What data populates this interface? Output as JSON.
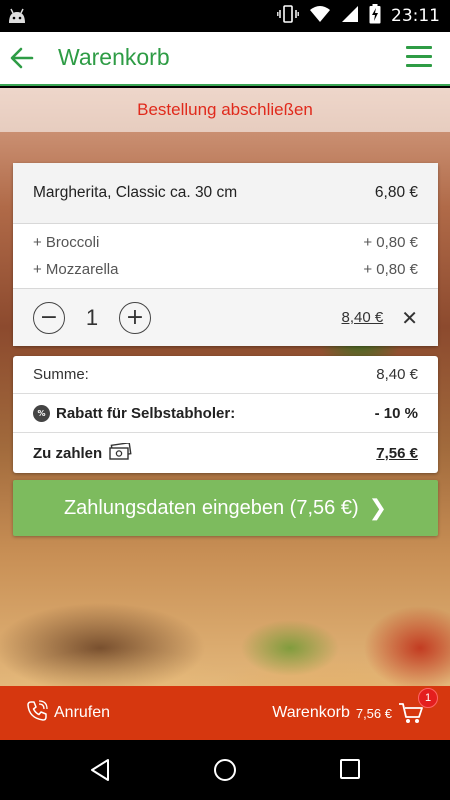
{
  "status_bar": {
    "time": "23:11"
  },
  "app_bar": {
    "title": "Warenkorb"
  },
  "banner": {
    "text": "Bestellung abschließen"
  },
  "item": {
    "name": "Margherita, Classic ca. 30 cm",
    "price": "6,80 €",
    "extras": [
      {
        "label": "+ Broccoli",
        "price": "+ 0,80 €"
      },
      {
        "label": "+ Mozzarella",
        "price": "+ 0,80 €"
      }
    ],
    "quantity": "1",
    "line_total": "8,40 €",
    "minus": "−",
    "plus": "+",
    "remove": "✕"
  },
  "summary": {
    "subtotal_label": "Summe:",
    "subtotal_value": "8,40 €",
    "discount_badge": "%",
    "discount_label": "Rabatt für Selbstabholer:",
    "discount_value": "- 10 %",
    "total_label": "Zu zahlen",
    "total_value": "7,56 €"
  },
  "pay_button": {
    "label": "Zahlungsdaten eingeben (7,56 €)",
    "chevron": "❯"
  },
  "action_bar": {
    "call_label": "Anrufen",
    "cart_label": "Warenkorb",
    "cart_price": "7,56 €",
    "cart_badge": "1"
  },
  "colors": {
    "brand_green": "#2e9c45",
    "banner_red": "#e02a1c",
    "pay_button_green": "#7dbb5e",
    "action_bar_red": "#d6370f"
  },
  "icons": [
    "android-icon",
    "vibrate-icon",
    "wifi-icon",
    "signal-icon",
    "battery-charging-icon",
    "back-arrow-icon",
    "hamburger-menu-icon",
    "percent-badge-icon",
    "money-icon",
    "phone-icon",
    "cart-icon",
    "nav-back-icon",
    "nav-home-icon",
    "nav-recents-icon"
  ]
}
